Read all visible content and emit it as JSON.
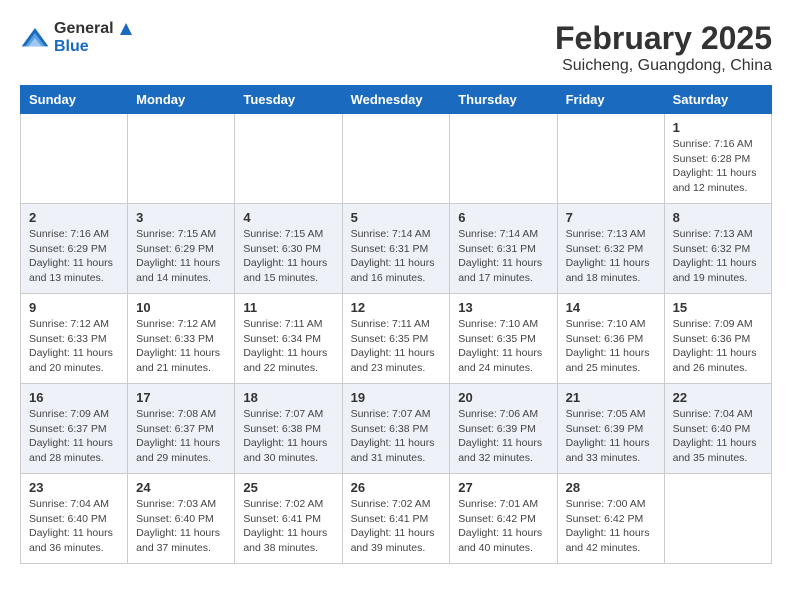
{
  "logo": {
    "general": "General",
    "blue": "Blue"
  },
  "title": "February 2025",
  "subtitle": "Suicheng, Guangdong, China",
  "weekdays": [
    "Sunday",
    "Monday",
    "Tuesday",
    "Wednesday",
    "Thursday",
    "Friday",
    "Saturday"
  ],
  "weeks": [
    [
      {
        "day": "",
        "info": ""
      },
      {
        "day": "",
        "info": ""
      },
      {
        "day": "",
        "info": ""
      },
      {
        "day": "",
        "info": ""
      },
      {
        "day": "",
        "info": ""
      },
      {
        "day": "",
        "info": ""
      },
      {
        "day": "1",
        "info": "Sunrise: 7:16 AM\nSunset: 6:28 PM\nDaylight: 11 hours\nand 12 minutes."
      }
    ],
    [
      {
        "day": "2",
        "info": "Sunrise: 7:16 AM\nSunset: 6:29 PM\nDaylight: 11 hours\nand 13 minutes."
      },
      {
        "day": "3",
        "info": "Sunrise: 7:15 AM\nSunset: 6:29 PM\nDaylight: 11 hours\nand 14 minutes."
      },
      {
        "day": "4",
        "info": "Sunrise: 7:15 AM\nSunset: 6:30 PM\nDaylight: 11 hours\nand 15 minutes."
      },
      {
        "day": "5",
        "info": "Sunrise: 7:14 AM\nSunset: 6:31 PM\nDaylight: 11 hours\nand 16 minutes."
      },
      {
        "day": "6",
        "info": "Sunrise: 7:14 AM\nSunset: 6:31 PM\nDaylight: 11 hours\nand 17 minutes."
      },
      {
        "day": "7",
        "info": "Sunrise: 7:13 AM\nSunset: 6:32 PM\nDaylight: 11 hours\nand 18 minutes."
      },
      {
        "day": "8",
        "info": "Sunrise: 7:13 AM\nSunset: 6:32 PM\nDaylight: 11 hours\nand 19 minutes."
      }
    ],
    [
      {
        "day": "9",
        "info": "Sunrise: 7:12 AM\nSunset: 6:33 PM\nDaylight: 11 hours\nand 20 minutes."
      },
      {
        "day": "10",
        "info": "Sunrise: 7:12 AM\nSunset: 6:33 PM\nDaylight: 11 hours\nand 21 minutes."
      },
      {
        "day": "11",
        "info": "Sunrise: 7:11 AM\nSunset: 6:34 PM\nDaylight: 11 hours\nand 22 minutes."
      },
      {
        "day": "12",
        "info": "Sunrise: 7:11 AM\nSunset: 6:35 PM\nDaylight: 11 hours\nand 23 minutes."
      },
      {
        "day": "13",
        "info": "Sunrise: 7:10 AM\nSunset: 6:35 PM\nDaylight: 11 hours\nand 24 minutes."
      },
      {
        "day": "14",
        "info": "Sunrise: 7:10 AM\nSunset: 6:36 PM\nDaylight: 11 hours\nand 25 minutes."
      },
      {
        "day": "15",
        "info": "Sunrise: 7:09 AM\nSunset: 6:36 PM\nDaylight: 11 hours\nand 26 minutes."
      }
    ],
    [
      {
        "day": "16",
        "info": "Sunrise: 7:09 AM\nSunset: 6:37 PM\nDaylight: 11 hours\nand 28 minutes."
      },
      {
        "day": "17",
        "info": "Sunrise: 7:08 AM\nSunset: 6:37 PM\nDaylight: 11 hours\nand 29 minutes."
      },
      {
        "day": "18",
        "info": "Sunrise: 7:07 AM\nSunset: 6:38 PM\nDaylight: 11 hours\nand 30 minutes."
      },
      {
        "day": "19",
        "info": "Sunrise: 7:07 AM\nSunset: 6:38 PM\nDaylight: 11 hours\nand 31 minutes."
      },
      {
        "day": "20",
        "info": "Sunrise: 7:06 AM\nSunset: 6:39 PM\nDaylight: 11 hours\nand 32 minutes."
      },
      {
        "day": "21",
        "info": "Sunrise: 7:05 AM\nSunset: 6:39 PM\nDaylight: 11 hours\nand 33 minutes."
      },
      {
        "day": "22",
        "info": "Sunrise: 7:04 AM\nSunset: 6:40 PM\nDaylight: 11 hours\nand 35 minutes."
      }
    ],
    [
      {
        "day": "23",
        "info": "Sunrise: 7:04 AM\nSunset: 6:40 PM\nDaylight: 11 hours\nand 36 minutes."
      },
      {
        "day": "24",
        "info": "Sunrise: 7:03 AM\nSunset: 6:40 PM\nDaylight: 11 hours\nand 37 minutes."
      },
      {
        "day": "25",
        "info": "Sunrise: 7:02 AM\nSunset: 6:41 PM\nDaylight: 11 hours\nand 38 minutes."
      },
      {
        "day": "26",
        "info": "Sunrise: 7:02 AM\nSunset: 6:41 PM\nDaylight: 11 hours\nand 39 minutes."
      },
      {
        "day": "27",
        "info": "Sunrise: 7:01 AM\nSunset: 6:42 PM\nDaylight: 11 hours\nand 40 minutes."
      },
      {
        "day": "28",
        "info": "Sunrise: 7:00 AM\nSunset: 6:42 PM\nDaylight: 11 hours\nand 42 minutes."
      },
      {
        "day": "",
        "info": ""
      }
    ]
  ]
}
